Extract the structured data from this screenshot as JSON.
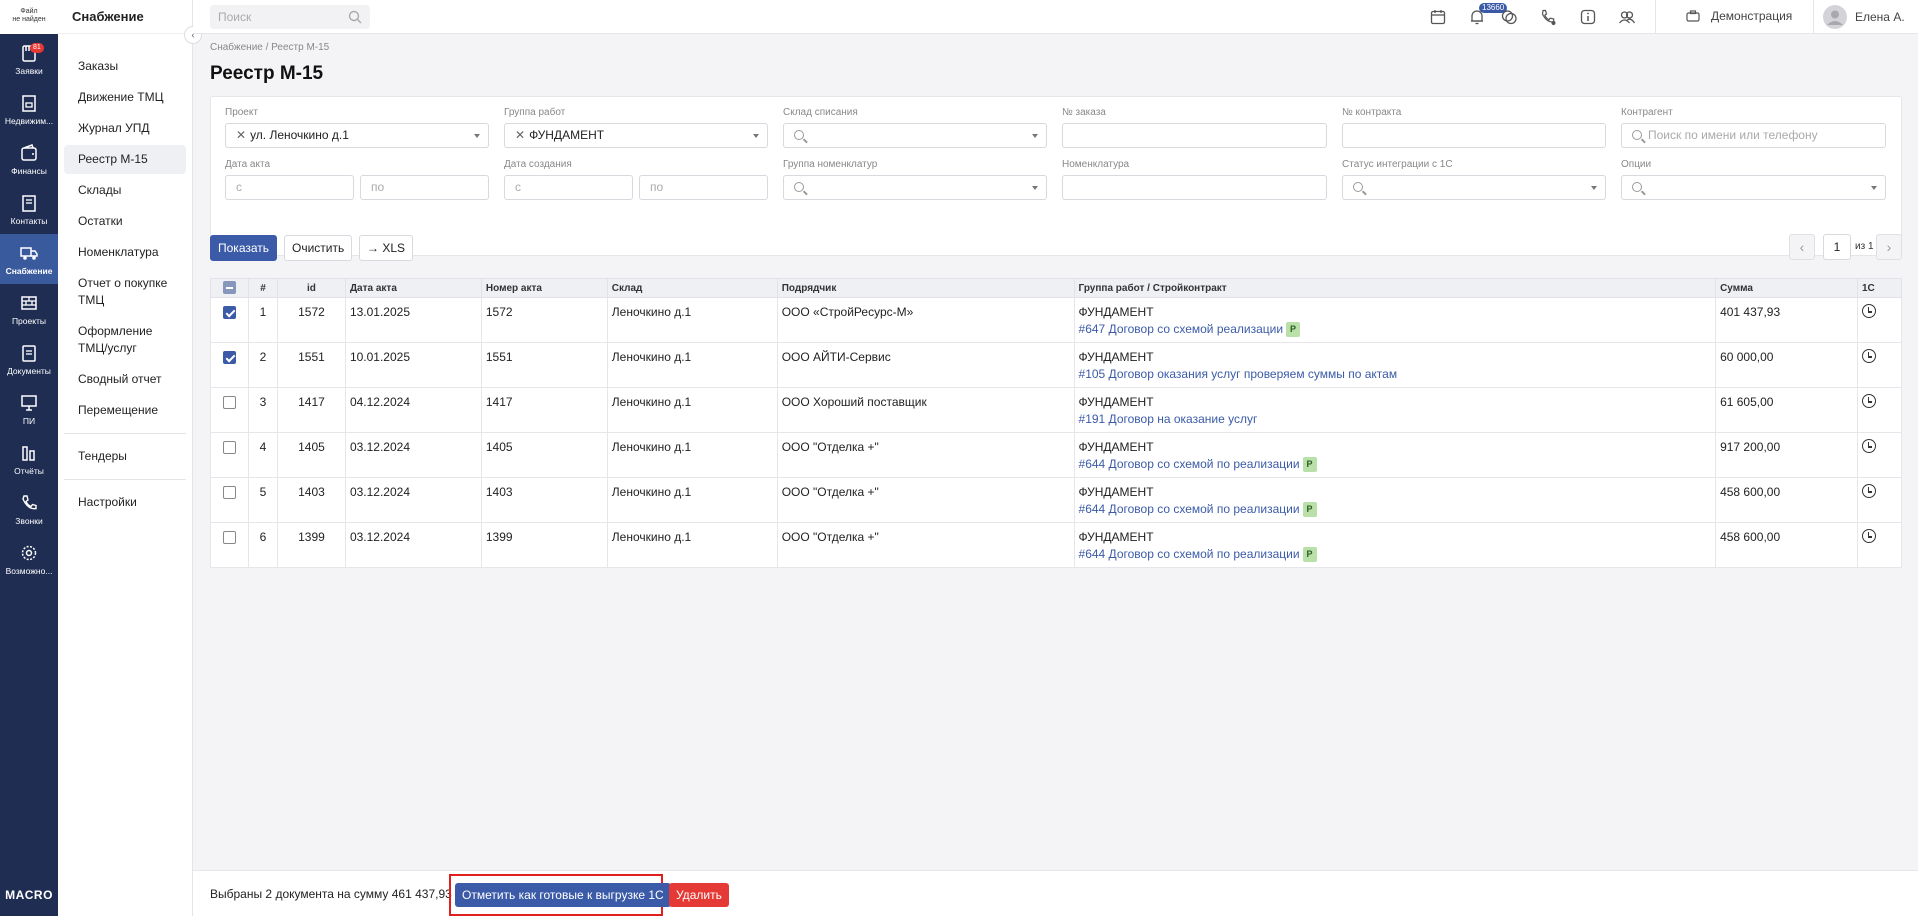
{
  "rail": {
    "logo": [
      "Файл",
      "не найден"
    ],
    "items": [
      {
        "label": "Заявки",
        "icon": "clipboard-icon",
        "badge": "81"
      },
      {
        "label": "Недвижим...",
        "icon": "building-icon"
      },
      {
        "label": "Финансы",
        "icon": "wallet-icon"
      },
      {
        "label": "Контакты",
        "icon": "contacts-icon"
      },
      {
        "label": "Снабжение",
        "icon": "truck-icon",
        "active": true
      },
      {
        "label": "Проекты",
        "icon": "bricks-icon"
      },
      {
        "label": "Документы",
        "icon": "document-icon"
      },
      {
        "label": "ПИ",
        "icon": "monitor-icon"
      },
      {
        "label": "Отчёты",
        "icon": "bar-chart-icon"
      },
      {
        "label": "Звонки",
        "icon": "phone-icon"
      },
      {
        "label": "Возможно...",
        "icon": "gear-icon"
      }
    ],
    "brand": "MACRO"
  },
  "subnav": {
    "title": "Снабжение",
    "items": [
      "Заказы",
      "Движение ТМЦ",
      "Журнал УПД",
      "Реестр М-15",
      "Склады",
      "Остатки",
      "Номенклатура",
      "Отчет о покупке ТМЦ",
      "Оформление ТМЦ/услуг",
      "Сводный отчет",
      "Перемещение",
      "Тендеры",
      "Настройки"
    ]
  },
  "topbar": {
    "search_placeholder": "Поиск",
    "notif_count": "13660",
    "demo_label": "Демонстрация",
    "user_name": "Елена А."
  },
  "page": {
    "breadcrumb": "Снабжение / Реестр М-15",
    "title": "Реестр М-15"
  },
  "filters": {
    "project_label": "Проект",
    "project_value": "ул. Леночкино д.1",
    "workgroup_label": "Группа работ",
    "workgroup_value": "ФУНДАМЕНТ",
    "warehouse_label": "Склад списания",
    "order_label": "№ заказа",
    "contract_label": "№ контракта",
    "counterparty_label": "Контрагент",
    "counterparty_placeholder": "Поиск по имени или телефону",
    "act_date_label": "Дата акта",
    "created_date_label": "Дата создания",
    "from_placeholder": "с",
    "to_placeholder": "по",
    "nomgroup_label": "Группа номенклатур",
    "nomenclature_label": "Номенклатура",
    "status1c_label": "Статус интеграции с 1С",
    "options_label": "Опции"
  },
  "actions": {
    "show": "Показать",
    "clear": "Очистить",
    "xls": "→ XLS",
    "page": "1",
    "of": "из 1"
  },
  "table": {
    "headers": [
      "#",
      "id",
      "Дата акта",
      "Номер акта",
      "Склад",
      "Подрядчик",
      "Группа работ / Стройконтракт",
      "Сумма",
      "1С"
    ],
    "rows": [
      {
        "checked": true,
        "n": "1",
        "id": "1572",
        "date": "13.01.2025",
        "num": "1572",
        "wh": "Леночкино д.1",
        "contractor": "ООО «СтройРесурс-М»",
        "group": "ФУНДАМЕНТ",
        "contract": "#647 Договор со схемой реализации",
        "tag": "Р",
        "sum": "401 437,93"
      },
      {
        "checked": true,
        "n": "2",
        "id": "1551",
        "date": "10.01.2025",
        "num": "1551",
        "wh": "Леночкино д.1",
        "contractor": "ООО АЙТИ-Сервис",
        "group": "ФУНДАМЕНТ",
        "contract": "#105 Договор оказания услуг проверяем суммы по актам",
        "tag": "",
        "sum": "60 000,00"
      },
      {
        "checked": false,
        "n": "3",
        "id": "1417",
        "date": "04.12.2024",
        "num": "1417",
        "wh": "Леночкино д.1",
        "contractor": "ООО Хороший поставщик",
        "group": "ФУНДАМЕНТ",
        "contract": "#191 Договор на оказание услуг",
        "tag": "",
        "sum": "61 605,00"
      },
      {
        "checked": false,
        "n": "4",
        "id": "1405",
        "date": "03.12.2024",
        "num": "1405",
        "wh": "Леночкино д.1",
        "contractor": "ООО \"Отделка +\"",
        "group": "ФУНДАМЕНТ",
        "contract": "#644 Договор со схемой по реализации",
        "tag": "Р",
        "sum": "917 200,00"
      },
      {
        "checked": false,
        "n": "5",
        "id": "1403",
        "date": "03.12.2024",
        "num": "1403",
        "wh": "Леночкино д.1",
        "contractor": "ООО \"Отделка +\"",
        "group": "ФУНДАМЕНТ",
        "contract": "#644 Договор со схемой по реализации",
        "tag": "Р",
        "sum": "458 600,00"
      },
      {
        "checked": false,
        "n": "6",
        "id": "1399",
        "date": "03.12.2024",
        "num": "1399",
        "wh": "Леночкино д.1",
        "contractor": "ООО \"Отделка +\"",
        "group": "ФУНДАМЕНТ",
        "contract": "#644 Договор со схемой по реализации",
        "tag": "Р",
        "sum": "458 600,00"
      }
    ]
  },
  "footer": {
    "summary": "Выбраны 2 документа на сумму 461 437,93 ₽",
    "mark_button": "Отметить как готовые к выгрузке 1С",
    "delete_button": "Удалить"
  },
  "colors": {
    "rail": "#1f2d52",
    "accent": "#3b5ba8",
    "danger": "#e53935",
    "tag": "#b8e0a8"
  }
}
